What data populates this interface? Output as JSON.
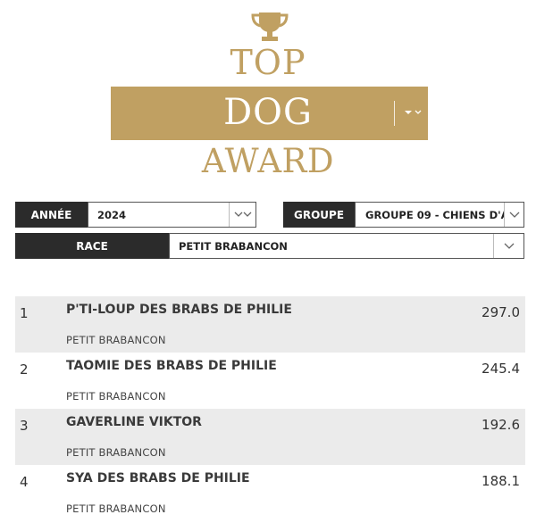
{
  "logo": {
    "top": "TOP",
    "dog": "DOG",
    "award": "AWARD",
    "gold_color": "#c0a062",
    "trophy_icon": "trophy-icon"
  },
  "filters": {
    "annee": {
      "label": "ANNÉE",
      "value": "2024"
    },
    "groupe": {
      "label": "GROUPE",
      "value": "GROUPE 09 - CHIENS D'A..."
    },
    "race": {
      "label": "RACE",
      "value": "PETIT BRABANCON"
    },
    "label_bg": "#2b2b2b"
  },
  "rankings": [
    {
      "rank": "1",
      "name": "P'TI-LOUP DES BRABS DE PHILIE",
      "breed": "PETIT BRABANCON",
      "score": "297.0"
    },
    {
      "rank": "2",
      "name": "TAOMIE DES BRABS DE PHILIE",
      "breed": "PETIT BRABANCON",
      "score": "245.4"
    },
    {
      "rank": "3",
      "name": "GAVERLINE VIKTOR",
      "breed": "PETIT BRABANCON",
      "score": "192.6"
    },
    {
      "rank": "4",
      "name": "SYA DES BRABS DE PHILIE",
      "breed": "PETIT BRABANCON",
      "score": "188.1"
    }
  ]
}
